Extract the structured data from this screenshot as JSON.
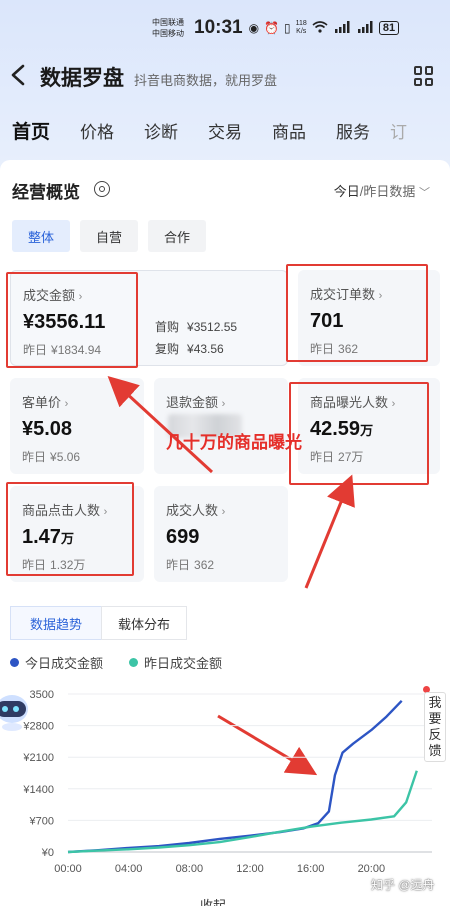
{
  "status_bar": {
    "carrier_1": "中国联通",
    "carrier_2": "中国移动",
    "time": "10:31",
    "net_speed_value": "118",
    "net_speed_unit": "K/s",
    "battery": "81"
  },
  "header": {
    "title": "数据罗盘",
    "subtitle": "抖音电商数据，就用罗盘"
  },
  "nav": {
    "tabs": [
      "首页",
      "价格",
      "诊断",
      "交易",
      "商品",
      "服务",
      "订"
    ],
    "active_index": 0
  },
  "overview": {
    "title": "经营概览",
    "date_selector": "今日",
    "date_selector_sub": "/昨日数据",
    "segments": [
      "整体",
      "自营",
      "合作"
    ],
    "active_segment": 0
  },
  "metrics": {
    "gmv": {
      "label": "成交金额",
      "value": "¥3556.11",
      "prev_label": "昨日",
      "prev_value": "¥1834.94",
      "first_label": "首购",
      "first_value": "¥3512.55",
      "repeat_label": "复购",
      "repeat_value": "¥43.56"
    },
    "orders": {
      "label": "成交订单数",
      "value": "701",
      "prev_label": "昨日",
      "prev_value": "362"
    },
    "aov": {
      "label": "客单价",
      "value": "¥5.08",
      "prev_label": "昨日",
      "prev_value": "¥5.06"
    },
    "refund": {
      "label": "退款金额"
    },
    "exposure": {
      "label": "商品曝光人数",
      "value": "42.59",
      "unit": "万",
      "prev_label": "昨日",
      "prev_value": "27万"
    },
    "clicks": {
      "label": "商品点击人数",
      "value": "1.47",
      "unit": "万",
      "prev_label": "昨日",
      "prev_value": "1.32万"
    },
    "buyers": {
      "label": "成交人数",
      "value": "699",
      "prev_label": "昨日",
      "prev_value": "362"
    }
  },
  "annotation": "几十万的商品曝光",
  "chart_tabs": [
    "数据趋势",
    "载体分布"
  ],
  "active_chart_tab": 0,
  "feedback": "我要反馈",
  "footer_text": "收起",
  "watermark": "知乎 @远舟",
  "colors": {
    "today": "#2d55c4",
    "yesterday": "#3cc4a6",
    "highlight": "#e23b33",
    "accent": "#2c64d9"
  },
  "chart_data": {
    "type": "line",
    "xlabel": "",
    "ylabel": "",
    "x_ticks": [
      "00:00",
      "04:00",
      "08:00",
      "12:00",
      "16:00",
      "20:00"
    ],
    "y_ticks": [
      "¥0",
      "¥700",
      "¥1400",
      "¥2100",
      "¥2800",
      "3500"
    ],
    "ylim": [
      0,
      3500
    ],
    "xlim": [
      0,
      24
    ],
    "series": [
      {
        "name": "今日成交金额",
        "x": [
          0,
          2,
          4,
          6,
          8,
          10,
          12,
          14,
          15.5,
          16.5,
          17.2,
          17.6,
          18.1,
          18.8,
          20,
          21,
          22
        ],
        "y": [
          0,
          40,
          90,
          130,
          200,
          290,
          360,
          440,
          520,
          640,
          900,
          1700,
          2200,
          2400,
          2700,
          3000,
          3350
        ]
      },
      {
        "name": "昨日成交金额",
        "x": [
          0,
          2,
          4,
          6,
          8,
          10,
          12,
          14,
          16,
          18,
          20,
          21.5,
          22.3,
          23
        ],
        "y": [
          0,
          30,
          60,
          100,
          150,
          220,
          330,
          450,
          560,
          650,
          720,
          790,
          1100,
          1800
        ]
      }
    ],
    "legend_position": "top-left"
  }
}
